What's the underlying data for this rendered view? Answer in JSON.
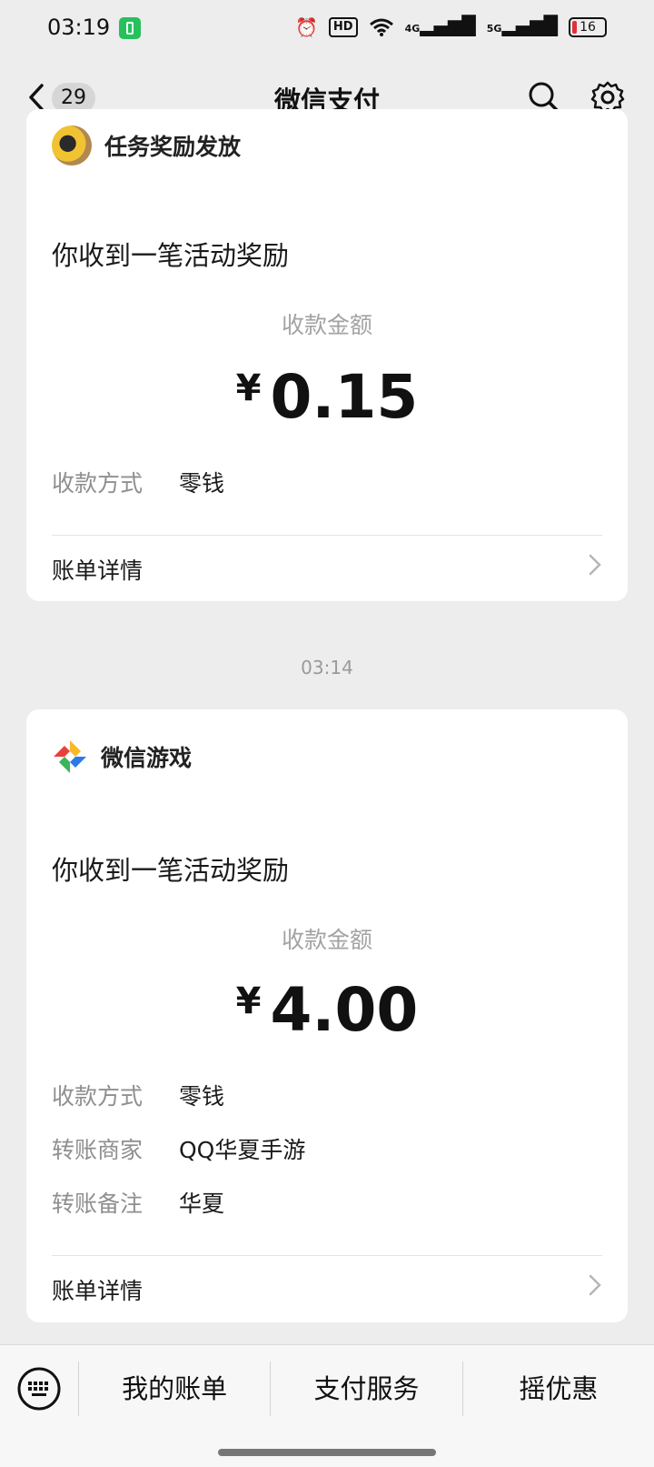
{
  "status_bar": {
    "time": "03:19",
    "battery": "16",
    "net1": "4G",
    "net2": "5G",
    "hd": "HD"
  },
  "nav": {
    "badge": "29",
    "title": "微信支付"
  },
  "cards": [
    {
      "app_name": "任务奖励发放",
      "heading": "你收到一笔活动奖励",
      "amount_label": "收款金额",
      "currency": "¥",
      "amount": "0.15",
      "rows": [
        {
          "key": "收款方式",
          "value": "零钱"
        }
      ],
      "detail_label": "账单详情"
    },
    {
      "app_name": "微信游戏",
      "heading": "你收到一笔活动奖励",
      "amount_label": "收款金额",
      "currency": "¥",
      "amount": "4.00",
      "rows": [
        {
          "key": "收款方式",
          "value": "零钱"
        },
        {
          "key": "转账商家",
          "value": "QQ华夏手游"
        },
        {
          "key": "转账备注",
          "value": "华夏"
        }
      ],
      "detail_label": "账单详情"
    }
  ],
  "timestamp": "03:14",
  "bottom": {
    "tabs": [
      "我的账单",
      "支付服务",
      "摇优惠"
    ]
  },
  "colors": {
    "background": "#ededed",
    "card": "#ffffff",
    "muted": "#a3a3a3",
    "battery_low": "#e0303a",
    "charging": "#26c05c"
  }
}
